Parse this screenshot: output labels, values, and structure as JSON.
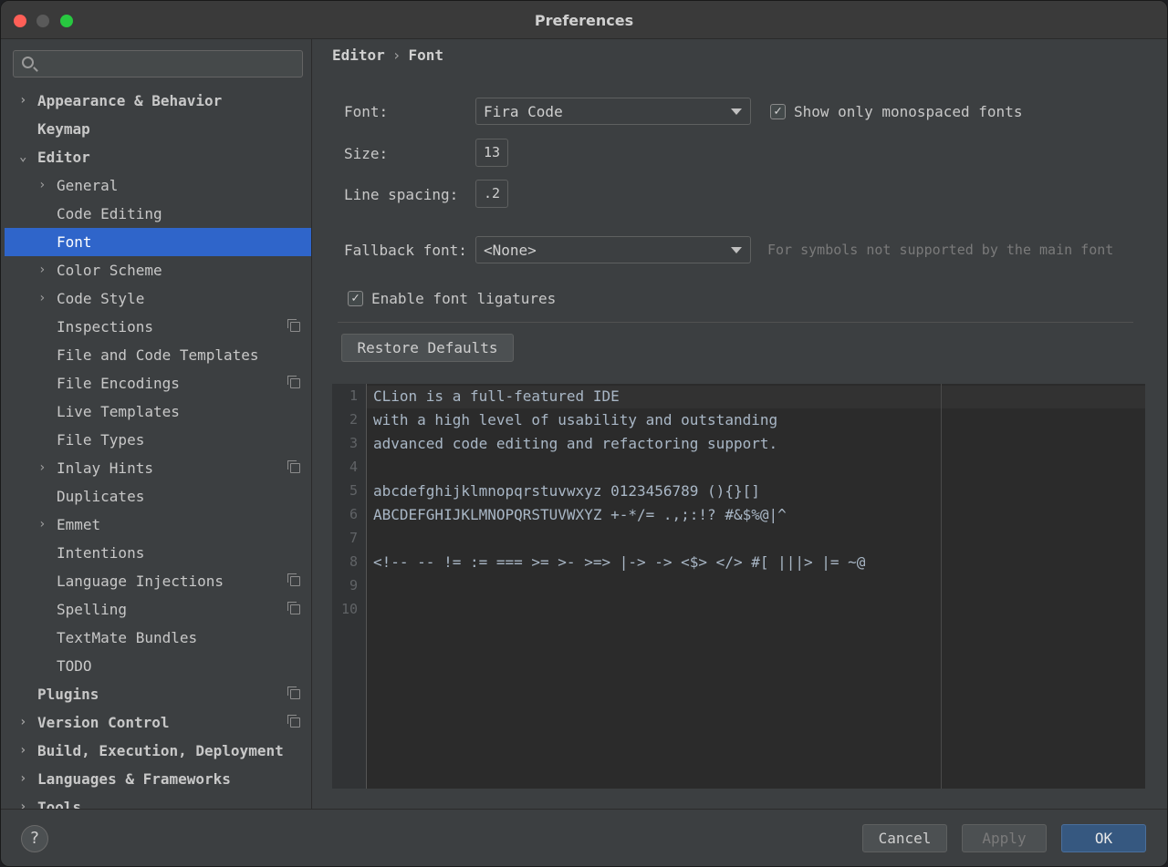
{
  "window": {
    "title": "Preferences"
  },
  "search": {
    "placeholder": ""
  },
  "sidebar": {
    "items": [
      {
        "label": "Appearance & Behavior",
        "level": 0,
        "chevron": "right",
        "bold": true,
        "copy": false
      },
      {
        "label": "Keymap",
        "level": 0,
        "chevron": "none",
        "bold": true,
        "copy": false
      },
      {
        "label": "Editor",
        "level": 0,
        "chevron": "down",
        "bold": true,
        "copy": false
      },
      {
        "label": "General",
        "level": 1,
        "chevron": "right",
        "bold": false,
        "copy": false
      },
      {
        "label": "Code Editing",
        "level": 1,
        "chevron": "none",
        "bold": false,
        "copy": false
      },
      {
        "label": "Font",
        "level": 1,
        "chevron": "none",
        "bold": false,
        "copy": false,
        "selected": true
      },
      {
        "label": "Color Scheme",
        "level": 1,
        "chevron": "right",
        "bold": false,
        "copy": false
      },
      {
        "label": "Code Style",
        "level": 1,
        "chevron": "right",
        "bold": false,
        "copy": false
      },
      {
        "label": "Inspections",
        "level": 1,
        "chevron": "none",
        "bold": false,
        "copy": true
      },
      {
        "label": "File and Code Templates",
        "level": 1,
        "chevron": "none",
        "bold": false,
        "copy": false
      },
      {
        "label": "File Encodings",
        "level": 1,
        "chevron": "none",
        "bold": false,
        "copy": true
      },
      {
        "label": "Live Templates",
        "level": 1,
        "chevron": "none",
        "bold": false,
        "copy": false
      },
      {
        "label": "File Types",
        "level": 1,
        "chevron": "none",
        "bold": false,
        "copy": false
      },
      {
        "label": "Inlay Hints",
        "level": 1,
        "chevron": "right",
        "bold": false,
        "copy": true
      },
      {
        "label": "Duplicates",
        "level": 1,
        "chevron": "none",
        "bold": false,
        "copy": false
      },
      {
        "label": "Emmet",
        "level": 1,
        "chevron": "right",
        "bold": false,
        "copy": false
      },
      {
        "label": "Intentions",
        "level": 1,
        "chevron": "none",
        "bold": false,
        "copy": false
      },
      {
        "label": "Language Injections",
        "level": 1,
        "chevron": "none",
        "bold": false,
        "copy": true
      },
      {
        "label": "Spelling",
        "level": 1,
        "chevron": "none",
        "bold": false,
        "copy": true
      },
      {
        "label": "TextMate Bundles",
        "level": 1,
        "chevron": "none",
        "bold": false,
        "copy": false
      },
      {
        "label": "TODO",
        "level": 1,
        "chevron": "none",
        "bold": false,
        "copy": false
      },
      {
        "label": "Plugins",
        "level": 0,
        "chevron": "none",
        "bold": true,
        "copy": true
      },
      {
        "label": "Version Control",
        "level": 0,
        "chevron": "right",
        "bold": true,
        "copy": true
      },
      {
        "label": "Build, Execution, Deployment",
        "level": 0,
        "chevron": "right",
        "bold": true,
        "copy": false
      },
      {
        "label": "Languages & Frameworks",
        "level": 0,
        "chevron": "right",
        "bold": true,
        "copy": false
      },
      {
        "label": "Tools",
        "level": 0,
        "chevron": "right",
        "bold": true,
        "copy": false
      }
    ]
  },
  "breadcrumb": {
    "parent": "Editor",
    "separator": "›",
    "current": "Font"
  },
  "font": {
    "label": "Font:",
    "value": "Fira Code",
    "monospaced_label": "Show only monospaced fonts",
    "monospaced_checked": true
  },
  "size": {
    "label": "Size:",
    "value": "13"
  },
  "line_spacing": {
    "label": "Line spacing:",
    "value": ".2"
  },
  "fallback": {
    "label": "Fallback font:",
    "value": "<None>",
    "hint": "For symbols not supported by the main font"
  },
  "ligatures": {
    "label": "Enable font ligatures",
    "checked": true
  },
  "restore_defaults": "Restore Defaults",
  "preview": {
    "lines": [
      "CLion is a full-featured IDE",
      "with a high level of usability and outstanding",
      "advanced code editing and refactoring support.",
      "",
      "abcdefghijklmnopqrstuvwxyz 0123456789 (){}[]",
      "ABCDEFGHIJKLMNOPQRSTUVWXYZ +-*/= .,;:!? #&$%@|^",
      "",
      "<!-- -- != := === >= >- >=> |-> -> <$> </> #[ |||> |= ~@",
      "",
      ""
    ]
  },
  "footer": {
    "help": "?",
    "cancel": "Cancel",
    "apply": "Apply",
    "ok": "OK"
  },
  "colors": {
    "accent": "#2f65ca",
    "ok_button": "#365880",
    "panel": "#3c3f41",
    "editor_bg": "#2b2b2b"
  }
}
